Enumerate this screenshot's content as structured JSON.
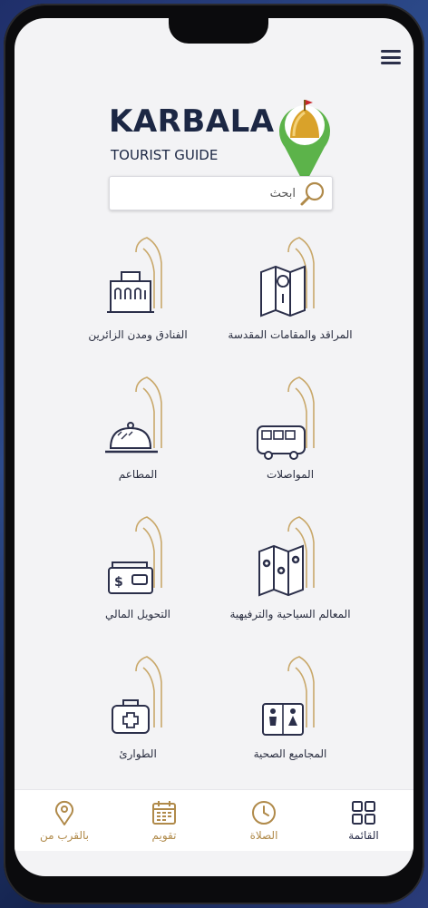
{
  "header": {
    "logo_title": "KARBALA",
    "logo_subtitle": "TOURIST GUIDE",
    "menu_icon": "hamburger-icon"
  },
  "search": {
    "placeholder": "ابحث",
    "icon": "search-icon"
  },
  "tiles": [
    {
      "label": "المراقد والمقامات المقدسة",
      "icon": "map-pin-icon"
    },
    {
      "label": "الفنادق ومدن الزائرين",
      "icon": "hotel-icon"
    },
    {
      "label": "المواصلات",
      "icon": "bus-icon"
    },
    {
      "label": "المطاعم",
      "icon": "food-tray-icon"
    },
    {
      "label": "المعالم السياحية والترفيهية",
      "icon": "folded-map-icon"
    },
    {
      "label": "التحويل المالي",
      "icon": "wallet-icon"
    },
    {
      "label": "المجاميع الصحية",
      "icon": "restroom-icon"
    },
    {
      "label": "الطوارئ",
      "icon": "first-aid-icon"
    }
  ],
  "bottom_nav": [
    {
      "label": "القائمة",
      "icon": "grid-icon",
      "active": true
    },
    {
      "label": "الصلاة",
      "icon": "clock-icon",
      "active": false
    },
    {
      "label": "تقويم",
      "icon": "calendar-icon",
      "active": false
    },
    {
      "label": "بالقرب من",
      "icon": "location-pin-icon",
      "active": false
    }
  ],
  "colors": {
    "accent_gold": "#b08a4a",
    "navy": "#1c2744",
    "pin_green": "#5cb34a",
    "dome_gold": "#d9a22a"
  }
}
